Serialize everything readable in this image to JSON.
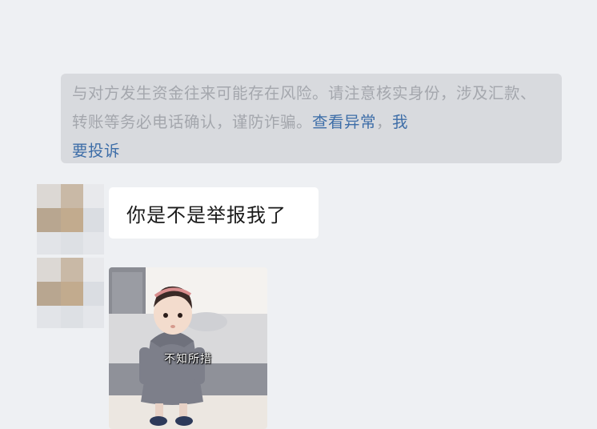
{
  "security_notice": {
    "text": "与对方发生资金往来可能存在风险。请注意核实身份，涉及汇款、转账等务必电话确认，谨防诈骗。",
    "link_view_abnormal": "查看异常",
    "separator": "，",
    "link_report_part1": "我",
    "link_report_part2": "要投诉"
  },
  "messages": [
    {
      "type": "text",
      "text": "你是不是举报我了"
    },
    {
      "type": "sticker",
      "caption": "不知所措"
    }
  ],
  "avatar_colors": [
    [
      "#dcd8d4",
      "#c9b9a6",
      "#e8e9ec"
    ],
    [
      "#b8a690",
      "#c2ab8e",
      "#dadde2"
    ],
    [
      "#e2e4e8",
      "#dde0e4",
      "#e4e6ea"
    ]
  ]
}
